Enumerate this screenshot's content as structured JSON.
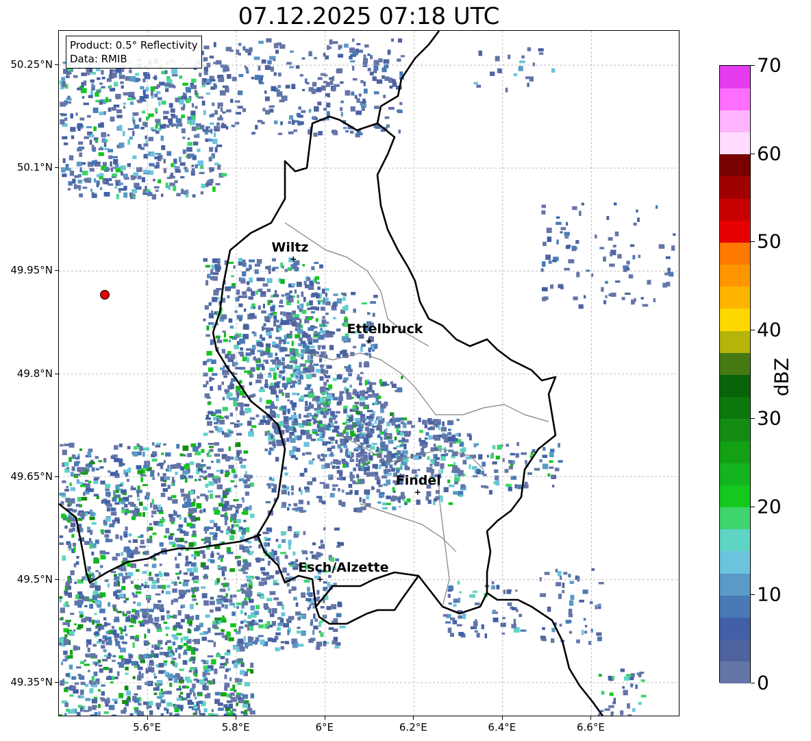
{
  "title": "07.12.2025 07:18 UTC",
  "info": {
    "product": "Product: 0.5° Reflectivity",
    "source": "Data: RMIB"
  },
  "lat_labels": [
    {
      "label": "50.25°N",
      "value": 50.25
    },
    {
      "label": "50.1°N",
      "value": 50.1
    },
    {
      "label": "49.95°N",
      "value": 49.95
    },
    {
      "label": "49.8°N",
      "value": 49.8
    },
    {
      "label": "49.65°N",
      "value": 49.65
    },
    {
      "label": "49.5°N",
      "value": 49.5
    },
    {
      "label": "49.35°N",
      "value": 49.35
    }
  ],
  "lon_labels": [
    {
      "label": "5.6°E",
      "value": 5.6
    },
    {
      "label": "5.8°E",
      "value": 5.8
    },
    {
      "label": "6°E",
      "value": 6.0
    },
    {
      "label": "6.2°E",
      "value": 6.2
    },
    {
      "label": "6.4°E",
      "value": 6.4
    },
    {
      "label": "6.6°E",
      "value": 6.6
    }
  ],
  "extent": {
    "lon_min": 5.4,
    "lon_max": 6.8,
    "lat_min": 49.3,
    "lat_max": 50.3
  },
  "cities": [
    {
      "name": "Wiltz",
      "lon": 5.93,
      "lat": 49.966
    },
    {
      "name": "Ettelbruck",
      "lon": 6.1,
      "lat": 49.847
    },
    {
      "name": "Findel",
      "lon": 6.21,
      "lat": 49.627
    },
    {
      "name": "Esch/Alzette",
      "lon": 5.99,
      "lat": 49.5
    }
  ],
  "radar_site": {
    "lon": 5.505,
    "lat": 49.914
  },
  "colorbar": {
    "label": "dBZ",
    "min": 0,
    "max": 70,
    "ticks": [
      {
        "label": "0",
        "value": 0
      },
      {
        "label": "10",
        "value": 10
      },
      {
        "label": "20",
        "value": 20
      },
      {
        "label": "30",
        "value": 30
      },
      {
        "label": "40",
        "value": 40
      },
      {
        "label": "50",
        "value": 50
      },
      {
        "label": "60",
        "value": 60
      },
      {
        "label": "70",
        "value": 70
      }
    ],
    "colors": [
      "#6475a8",
      "#4f639e",
      "#4260a5",
      "#4a7ab5",
      "#5a9ac6",
      "#6bc4de",
      "#5ed4c4",
      "#3ed46e",
      "#14c81e",
      "#14b41e",
      "#14a014",
      "#148c14",
      "#0c780c",
      "#086408",
      "#467814",
      "#b4b40a",
      "#ffd700",
      "#ffb400",
      "#ff9600",
      "#ff7800",
      "#e60000",
      "#c80000",
      "#a00000",
      "#780000",
      "#ffdcff",
      "#ffb4ff",
      "#ff6eff",
      "#e63cf0"
    ]
  },
  "colors": {
    "border_country": "#000000",
    "border_canton": "#808080",
    "grid": "#b0b0b0"
  }
}
